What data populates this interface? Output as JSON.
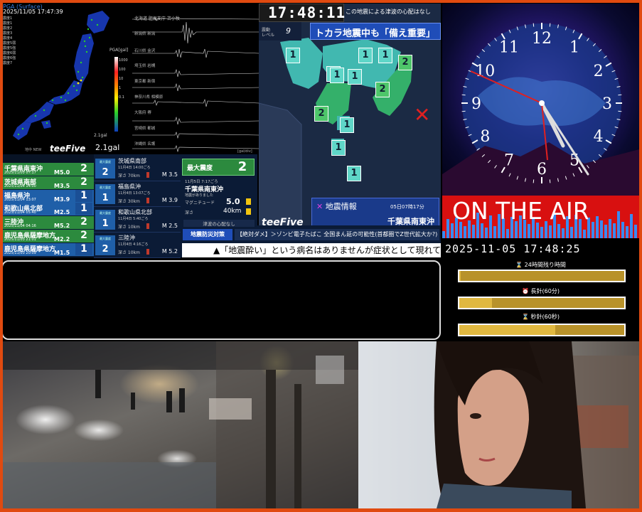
{
  "pga": {
    "title": "PGA (Surface)",
    "time": "2025/11/05 17:47:39",
    "stats": [
      "震度1",
      "震度1",
      "震度2",
      "震度3",
      "震度4",
      "震度5弱",
      "震度5強",
      "震度6弱",
      "震度6強",
      "震度7"
    ],
    "unit": "PGA[gal]",
    "ticks": [
      "1000",
      "100",
      "10",
      "1",
      "0.1"
    ],
    "max_label": "2.1gal",
    "small": "2.1gal"
  },
  "waveforms": {
    "header": "北海道 胆振支庁 苫小牧",
    "stations": [
      "新潟県 新潟",
      "石川県 金沢",
      "埼玉県 岩槻",
      "東京都 新宿",
      "神奈川県 相模原",
      "大阪府 堺",
      "宮崎県 都城",
      "沖縄県 名護"
    ],
    "unit": "[gal/div]"
  },
  "eq_list": {
    "header": "地中 NEW",
    "brand": "teeFive",
    "rows": [
      {
        "name": "千葉県南東沖",
        "date": "2025/11/05 07:17",
        "mag": "M5.0",
        "intensity": "2",
        "color": "green"
      },
      {
        "name": "茨城県南部",
        "date": "2025/11/04 14:00",
        "mag": "M3.5",
        "intensity": "2",
        "color": "green"
      },
      {
        "name": "福島県沖",
        "date": "2025/11/04 13:07",
        "mag": "M3.9",
        "intensity": "1",
        "color": "blue"
      },
      {
        "name": "和歌山県北部",
        "date": "2025/11/04 05:40",
        "mag": "M2.5",
        "intensity": "1",
        "color": "blue"
      },
      {
        "name": "三陸沖",
        "date": "2025/11/04 04:16",
        "mag": "M5.2",
        "intensity": "2",
        "color": "green"
      },
      {
        "name": "鹿児島県薩摩地方",
        "date": "2025/11/03 21:01",
        "mag": "M2.2",
        "intensity": "2",
        "color": "green"
      },
      {
        "name": "鹿児島県薩摩地方",
        "date": "2025/11/03 20:09",
        "mag": "M1.5",
        "intensity": "1",
        "color": "blue"
      }
    ]
  },
  "eq_cards": [
    {
      "badge_label": "最大震度",
      "intensity": "2",
      "name": "茨城県南部",
      "date": "11月4日 14:00ごろ",
      "depth": "深さ 70km",
      "mag": "M 3.5"
    },
    {
      "badge_label": "最大震度",
      "intensity": "1",
      "name": "福島県沖",
      "date": "11月4日 13:07ごろ",
      "depth": "深さ 30km",
      "mag": "M 3.9"
    },
    {
      "badge_label": "最大震度",
      "intensity": "1",
      "name": "和歌山県北部",
      "date": "11月4日 5:40ごろ",
      "depth": "深さ 10km",
      "mag": "M 2.5"
    },
    {
      "badge_label": "最大震度",
      "intensity": "2",
      "name": "三陸沖",
      "date": "11月4日 4:16ごろ",
      "depth": "深さ 10km",
      "mag": "M 5.2"
    }
  ],
  "max_intensity": {
    "label": "最大震度",
    "value": "2",
    "date": "11月5日 7:17ごろ",
    "place": "千葉県南東沖",
    "note": "地震がありました",
    "mag_label": "マグニチュード",
    "mag": "5.0",
    "depth_label": "深さ",
    "depth": "40km"
  },
  "tokai": {
    "time": "17:48:11",
    "tsunami_top": "",
    "tsunami_note": "この地震による津波の心配はなし",
    "level_label": "震動\nレベル",
    "level": "9",
    "headline": "トカラ地震中も「備え重要」",
    "info_title": "地震情報",
    "info_time": "05日07時17分",
    "info_place": "千葉県南東沖",
    "brand": "teeFive",
    "intensities": [
      "1",
      "1",
      "1",
      "1",
      "2",
      "1",
      "1",
      "2",
      "2",
      "1",
      "1",
      "1"
    ]
  },
  "ticker": {
    "tsunami_small": "津波の心配なし",
    "label": "地震防災対策",
    "news": "【絶対ダメ】＞ゾンビ電子たばこ 全国まん延の可能性(首都圏でZ世代拡大か?)",
    "main": "▲「地震酔い」という病名はありませんが症状として現れています"
  },
  "clock": {
    "numbers": [
      "12",
      "1",
      "2",
      "3",
      "4",
      "5",
      "6",
      "7",
      "8",
      "9",
      "10",
      "11"
    ],
    "onair": "ON THE AIR",
    "datetime": "2025-11-05 17:48:25"
  },
  "progress": [
    {
      "label": "24時間残り時間",
      "icon": "hourglass-icon",
      "fraction": 0.01
    },
    {
      "label": "長針(60分)",
      "icon": "clock-icon",
      "fraction": 0.2
    },
    {
      "label": "秒針(60秒)",
      "icon": "hourglass-icon",
      "fraction": 0.58
    }
  ]
}
